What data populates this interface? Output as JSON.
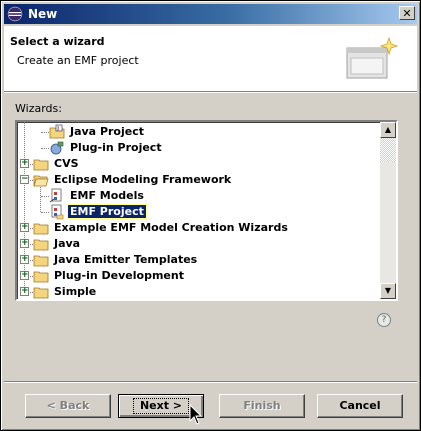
{
  "window": {
    "title": "New"
  },
  "header": {
    "title": "Select a wizard",
    "description": "Create an EMF project"
  },
  "wizards_label": "Wizards:",
  "tree": {
    "items": [
      {
        "label": "Java Project",
        "icon": "java-project-icon",
        "level": 1,
        "expander": ""
      },
      {
        "label": "Plug-in Project",
        "icon": "plugin-project-icon",
        "level": 1,
        "expander": ""
      },
      {
        "label": "CVS",
        "icon": "folder-icon",
        "level": 0,
        "expander": "+"
      },
      {
        "label": "Eclipse Modeling Framework",
        "icon": "folder-open-icon",
        "level": 0,
        "expander": "-"
      },
      {
        "label": "EMF Models",
        "icon": "emf-models-icon",
        "level": 1,
        "expander": ""
      },
      {
        "label": "EMF Project",
        "icon": "emf-project-icon",
        "level": 1,
        "expander": "",
        "selected": true
      },
      {
        "label": "Example EMF Model Creation Wizards",
        "icon": "folder-icon",
        "level": 0,
        "expander": "+"
      },
      {
        "label": "Java",
        "icon": "folder-icon",
        "level": 0,
        "expander": "+"
      },
      {
        "label": "Java Emitter Templates",
        "icon": "folder-icon",
        "level": 0,
        "expander": "+"
      },
      {
        "label": "Plug-in Development",
        "icon": "folder-icon",
        "level": 0,
        "expander": "+"
      },
      {
        "label": "Simple",
        "icon": "folder-icon",
        "level": 0,
        "expander": "+"
      }
    ]
  },
  "buttons": {
    "back": "< Back",
    "next": "Next >",
    "finish": "Finish",
    "cancel": "Cancel"
  },
  "colors": {
    "title_bar": "#0a246a",
    "selection": "#0a246a",
    "face": "#d4d0c8"
  }
}
